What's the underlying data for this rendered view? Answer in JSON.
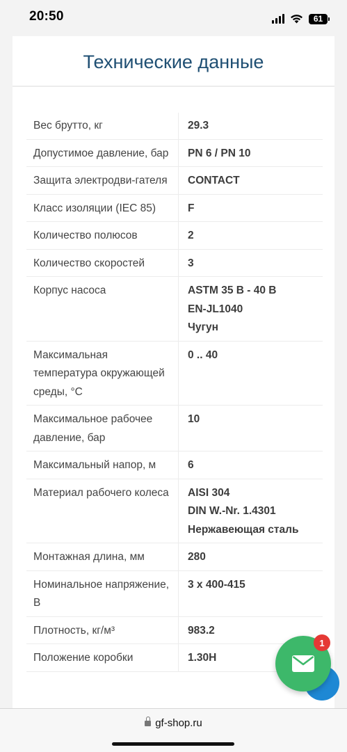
{
  "status_bar": {
    "time": "20:50",
    "battery": "61"
  },
  "page": {
    "title": "Технические данные"
  },
  "specs": [
    {
      "label": "Вес брутто, кг",
      "value": [
        "29.3"
      ]
    },
    {
      "label": "Допустимое давление, бар",
      "value": [
        "PN 6 / PN 10"
      ]
    },
    {
      "label": "Защита электродви-гателя",
      "value": [
        "CONTACT"
      ]
    },
    {
      "label": "Класс изоляции (IEC 85)",
      "value": [
        "F"
      ]
    },
    {
      "label": "Количество полюсов",
      "value": [
        "2"
      ]
    },
    {
      "label": "Количество скоростей",
      "value": [
        "3"
      ]
    },
    {
      "label": "Корпус насоса",
      "value": [
        "ASTM 35 B - 40 B",
        "EN-JL1040",
        "Чугун"
      ]
    },
    {
      "label": "Максимальная температура окружающей среды, °C",
      "value": [
        "0 .. 40"
      ]
    },
    {
      "label": "Максимальное рабочее давление, бар",
      "value": [
        "10"
      ]
    },
    {
      "label": "Максимальный напор, м",
      "value": [
        "6"
      ]
    },
    {
      "label": "Материал рабочего колеса",
      "value": [
        "AISI 304",
        "DIN W.-Nr. 1.4301",
        "Нержавеющая сталь"
      ]
    },
    {
      "label": "Монтажная длина, мм",
      "value": [
        "280"
      ]
    },
    {
      "label": "Номинальное напряжение, В",
      "value": [
        "3 x 400-415"
      ]
    },
    {
      "label": "Плотность, кг/м³",
      "value": [
        "983.2"
      ]
    },
    {
      "label": "Положение коробки",
      "value": [
        "1.30H"
      ]
    }
  ],
  "fab": {
    "badge_count": "1"
  },
  "browser": {
    "url": "gf-shop.ru"
  },
  "colors": {
    "title": "#1f4f73",
    "mail_button": "#3db86a",
    "scroll_button": "#1e88d4",
    "badge": "#e53935"
  },
  "icons": [
    "signal-icon",
    "wifi-icon",
    "battery-icon",
    "mail-icon",
    "lock-icon"
  ]
}
